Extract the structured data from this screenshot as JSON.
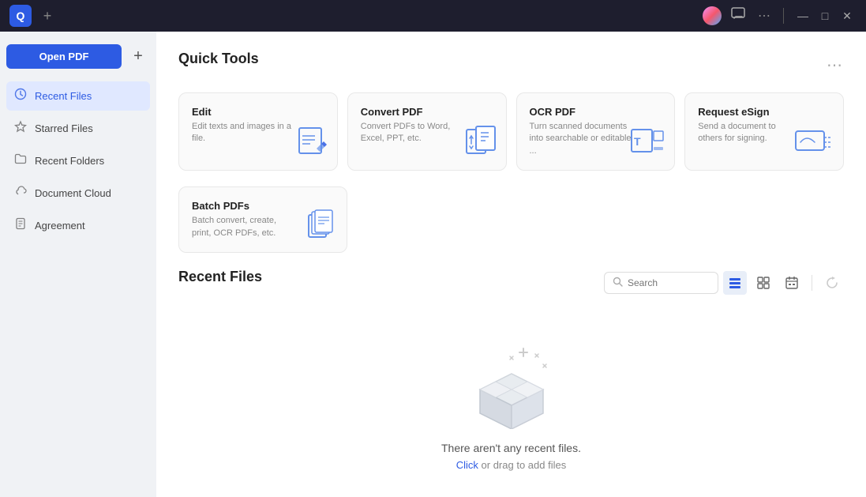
{
  "titlebar": {
    "logo_letter": "Q",
    "new_tab_label": "+",
    "avatar_alt": "user avatar",
    "chat_icon": "💬",
    "more_icon": "⋯",
    "min_icon": "—",
    "max_icon": "□",
    "close_icon": "✕"
  },
  "sidebar": {
    "open_pdf_label": "Open PDF",
    "add_label": "+",
    "items": [
      {
        "id": "recent-files",
        "label": "Recent Files",
        "icon": "🕐",
        "active": true
      },
      {
        "id": "starred-files",
        "label": "Starred Files",
        "icon": "☆",
        "active": false
      },
      {
        "id": "recent-folders",
        "label": "Recent Folders",
        "icon": "📁",
        "active": false
      },
      {
        "id": "document-cloud",
        "label": "Document Cloud",
        "icon": "☁",
        "active": false
      },
      {
        "id": "agreement",
        "label": "Agreement",
        "icon": "📄",
        "active": false
      }
    ]
  },
  "quick_tools": {
    "section_title": "Quick Tools",
    "more_icon": "⋯",
    "tools": [
      {
        "id": "edit",
        "name": "Edit",
        "description": "Edit texts and images in a file.",
        "icon_type": "edit"
      },
      {
        "id": "convert-pdf",
        "name": "Convert PDF",
        "description": "Convert PDFs to Word, Excel, PPT, etc.",
        "icon_type": "convert"
      },
      {
        "id": "ocr-pdf",
        "name": "OCR PDF",
        "description": "Turn scanned documents into searchable or editable ...",
        "icon_type": "ocr"
      },
      {
        "id": "request-esign",
        "name": "Request eSign",
        "description": "Send a document to others for signing.",
        "icon_type": "esign"
      }
    ],
    "batch_tool": {
      "id": "batch-pdfs",
      "name": "Batch PDFs",
      "description": "Batch convert, create, print, OCR PDFs, etc.",
      "icon_type": "batch"
    }
  },
  "recent_files": {
    "section_title": "Recent Files",
    "search_placeholder": "Search",
    "empty_message": "There aren't any recent files.",
    "empty_subtext_prefix": "",
    "empty_click_label": "Click",
    "empty_subtext_middle": " or drag",
    "empty_subtext_suffix": " to add files"
  }
}
